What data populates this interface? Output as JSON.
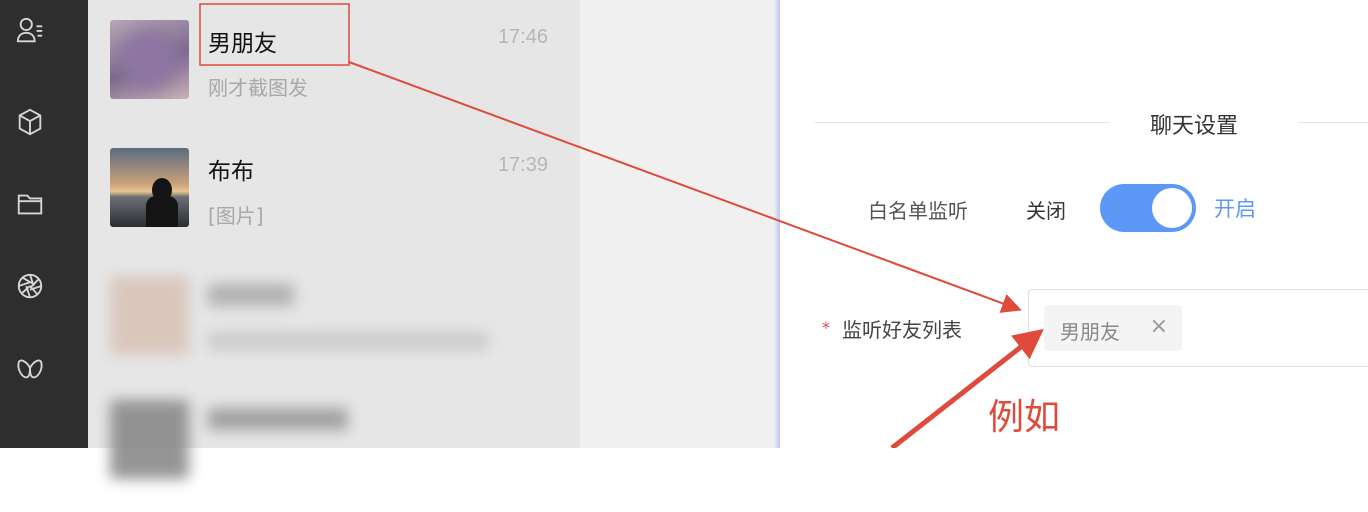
{
  "sidebar": {
    "icons": [
      "contacts-icon",
      "cube-icon",
      "folder-icon",
      "aperture-icon",
      "butterfly-icon"
    ]
  },
  "chats": [
    {
      "name": "男朋友",
      "time": "17:46",
      "preview": "刚才截图发"
    },
    {
      "name": "布布",
      "time": "17:39",
      "preview": "[图片]"
    }
  ],
  "settings": {
    "section_title": "聊天设置",
    "whitelist_label": "白名单监听",
    "off_label": "关闭",
    "on_label": "开启",
    "toggle_on": true,
    "required_mark": "*",
    "friend_list_label": "监听好友列表",
    "tag_text": "男朋友",
    "tag_close": "×"
  },
  "annotation": {
    "example_text": "例如",
    "color": "#e04a3a"
  },
  "colors": {
    "accent": "#5e98f6",
    "rail": "#2e2e2e",
    "chatlist": "#e6e6e6"
  }
}
